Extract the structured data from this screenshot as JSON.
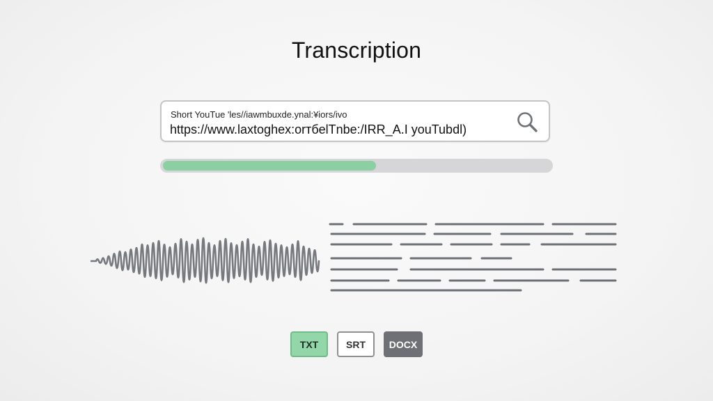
{
  "page": {
    "title": "Transcription"
  },
  "url_input": {
    "label": "Short YouTue 'les//iawmbuxde.ynal:¥iors/ivo",
    "value": "https://www.laxtoghex:orтбelTnbe:/IRR_A.I youTubdl)"
  },
  "search": {
    "icon": "search-icon"
  },
  "progress": {
    "fraction": 0.55,
    "color": "#8ccfa3"
  },
  "waveform": {
    "icon": "audio-waveform-icon",
    "color": "#76797e"
  },
  "transcript_preview": {
    "icon": "text-lines-icon",
    "color": "#6c6f74"
  },
  "formats": {
    "txt": "TXT",
    "srt": "SRT",
    "docx": "DOCX"
  },
  "colors": {
    "accent_green": "#93d6a9",
    "dark_gray": "#6e7075"
  }
}
